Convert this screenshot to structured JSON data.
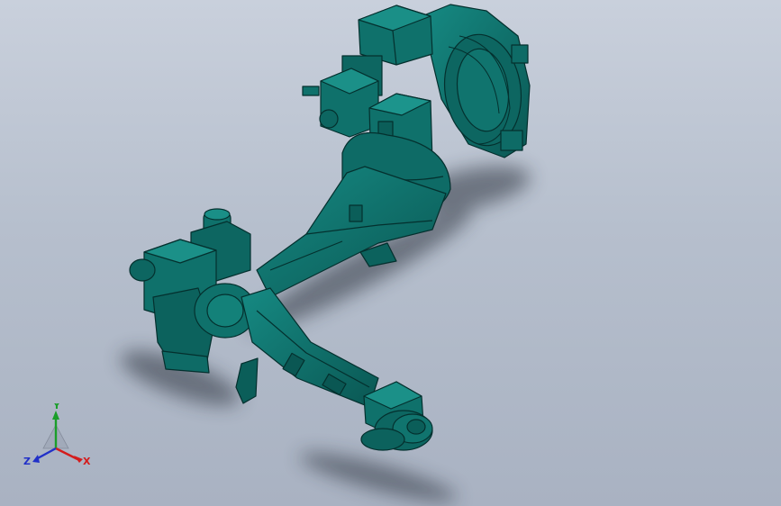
{
  "viewport": {
    "background_top": "#c9d0dc",
    "background_bottom": "#a9b2c2"
  },
  "model": {
    "body_color": "#0e6b66",
    "edge_color": "#04302e",
    "shadow_color": "#2f3540"
  },
  "triad": {
    "x_label": "X",
    "y_label": "Y",
    "z_label": "Z",
    "x_color": "#d41c1c",
    "y_color": "#1a9e2a",
    "z_color": "#2130c8"
  }
}
